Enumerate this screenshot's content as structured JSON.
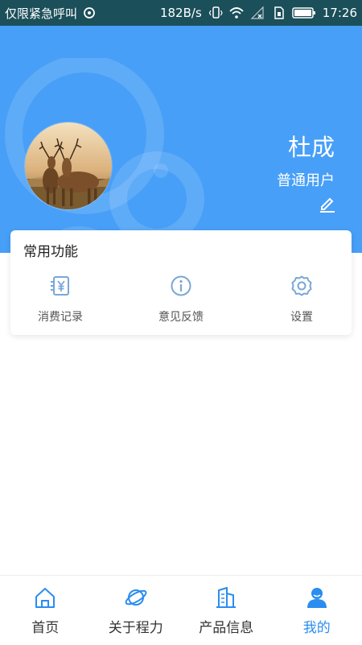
{
  "status_bar": {
    "carrier": "仅限紧急呼叫",
    "speed": "182B/s",
    "time": "17:26",
    "icons": [
      "location-icon",
      "vibrate-icon",
      "wifi-icon",
      "no-signal-icon",
      "sim-icon",
      "battery-icon"
    ]
  },
  "profile": {
    "name": "杜成",
    "role": "普通用户",
    "avatar": "deer-photo",
    "edit_icon": "pencil-icon"
  },
  "common_functions": {
    "title": "常用功能",
    "items": [
      {
        "label": "消费记录",
        "icon": "bill-yen-icon"
      },
      {
        "label": "意见反馈",
        "icon": "info-icon"
      },
      {
        "label": "设置",
        "icon": "gear-icon"
      }
    ]
  },
  "bottom_nav": {
    "items": [
      {
        "label": "首页",
        "icon": "home-icon"
      },
      {
        "label": "关于程力",
        "icon": "planet-icon"
      },
      {
        "label": "产品信息",
        "icon": "building-icon"
      },
      {
        "label": "我的",
        "icon": "user-icon",
        "active": true
      }
    ]
  },
  "colors": {
    "header_bg": "#479ff7",
    "status_bg": "#1b4f5a",
    "icon_blue": "#2a8df0",
    "icon_light": "#7aa7d6"
  }
}
